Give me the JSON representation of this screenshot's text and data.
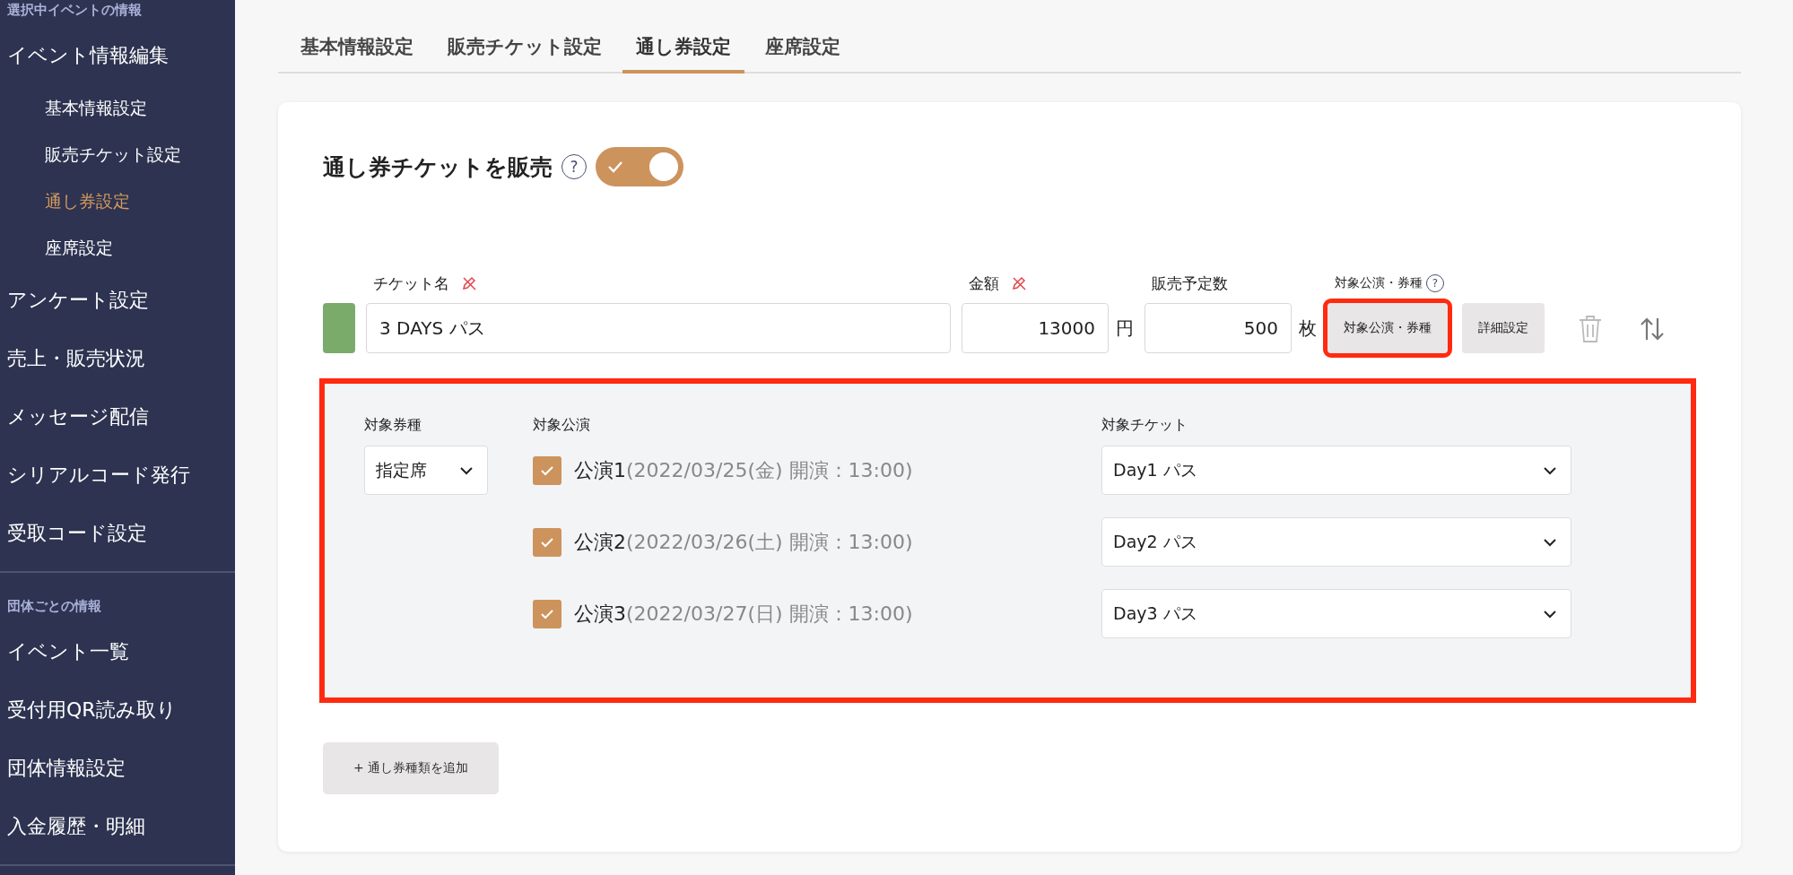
{
  "sidebar": {
    "sections": [
      {
        "heading": "選択中イベントの情報",
        "items": [
          {
            "label": "イベント情報編集",
            "selected": false,
            "children": [
              {
                "label": "基本情報設定",
                "selected": false
              },
              {
                "label": "販売チケット設定",
                "selected": false
              },
              {
                "label": "通し券設定",
                "selected": true
              },
              {
                "label": "座席設定",
                "selected": false
              }
            ]
          },
          {
            "label": "アンケート設定",
            "selected": false
          },
          {
            "label": "売上・販売状況",
            "selected": false
          },
          {
            "label": "メッセージ配信",
            "selected": false
          },
          {
            "label": "シリアルコード発行",
            "selected": false
          },
          {
            "label": "受取コード設定",
            "selected": false
          }
        ]
      },
      {
        "heading": "団体ごとの情報",
        "items": [
          {
            "label": "イベント一覧",
            "selected": false
          },
          {
            "label": "受付用QR読み取り",
            "selected": false
          },
          {
            "label": "団体情報設定",
            "selected": false
          },
          {
            "label": "入金履歴・明細",
            "selected": false
          }
        ]
      }
    ]
  },
  "tabs": [
    {
      "label": "基本情報設定",
      "selected": false
    },
    {
      "label": "販売チケット設定",
      "selected": false
    },
    {
      "label": "通し券設定",
      "selected": true
    },
    {
      "label": "座席設定",
      "selected": false
    }
  ],
  "sale_toggle": {
    "label": "通し券チケットを販売",
    "help": "?",
    "on": true
  },
  "ticket": {
    "color": "#7aab6a",
    "name_label": "チケット名",
    "name": "3 DAYS パス",
    "price_label": "金額",
    "price": "13000",
    "price_unit": "円",
    "quantity_label": "販売予定数",
    "quantity": "500",
    "quantity_unit": "枚",
    "target_label": "対象公演・券種",
    "target_help": "?",
    "target_button": "対象公演・券種",
    "target_highlighted": true,
    "detail_button": "詳細設定"
  },
  "target_panel": {
    "highlighted": true,
    "type_label": "対象券種",
    "type_value": "指定席",
    "performance_label": "対象公演",
    "ticket_label": "対象チケット",
    "performances": [
      {
        "name": "公演1",
        "detail": "(2022/03/25(金) 開演：13:00)",
        "checked": true,
        "ticket": "Day1 パス"
      },
      {
        "name": "公演2",
        "detail": "(2022/03/26(土) 開演：13:00)",
        "checked": true,
        "ticket": "Day2 パス"
      },
      {
        "name": "公演3",
        "detail": "(2022/03/27(日) 開演：13:00)",
        "checked": true,
        "ticket": "Day3 パス"
      }
    ]
  },
  "add_button": "+ 通し券種類を追加"
}
